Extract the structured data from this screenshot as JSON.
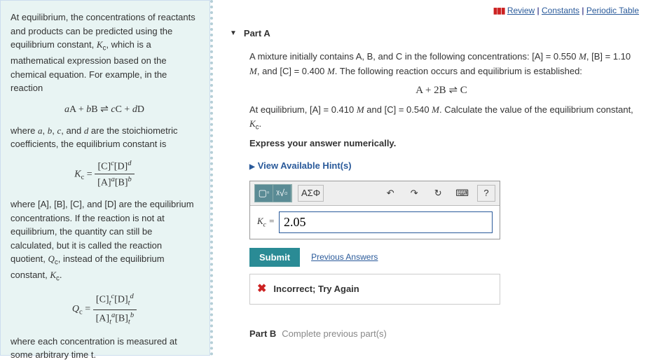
{
  "toplinks": {
    "review": "Review",
    "constants": "Constants",
    "periodic": "Periodic Table"
  },
  "left": {
    "intro": "At equilibrium, the concentrations of reactants and products can be predicted using the equilibrium constant, Kc, which is a mathematical expression based on the chemical equation. For example, in the reaction",
    "gen_eq": "aA + bB ⇌ cC + dD",
    "stoich": "where a, b, c, and d are the stoichiometric coefficients, the equilibrium constant is",
    "kc_label": "K",
    "kc_sub": "c",
    "kc_num": "[C]ᶜ[D]ᵈ",
    "kc_den": "[A]ᵃ[B]ᵇ",
    "where_eq": "where [A], [B], [C], and [D] are the equilibrium concentrations. If the reaction is not at equilibrium, the quantity can still be calculated, but it is called the reaction quotient, Qc, instead of the equilibrium constant, Kc.",
    "qc_label": "Q",
    "qc_sub": "c",
    "qc_num": "[C]ₜᶜ[D]ₜᵈ",
    "qc_den": "[A]ₜᵃ[B]ₜᵇ",
    "arb_time": "where each concentration is measured at some arbitrary time t."
  },
  "partA": {
    "label": "Part A",
    "q1a": "A mixture initially contains A, B, and C in the following concentrations: [A] = 0.550 ",
    "q1b": ", [B] = 1.10 ",
    "q1c": ", and [C] = 0.400 ",
    "q1d": ". The following reaction occurs and equilibrium is established:",
    "M": "M",
    "react_eq": "A + 2B ⇌ C",
    "q2a": "At equilibrium, [A] = 0.410 ",
    "q2b": " and [C] = 0.540 ",
    "q2c": ". Calculate the value of the equilibrium constant, ",
    "kc": "Kc",
    "express": "Express your answer numerically.",
    "hints": "View Available Hint(s)",
    "toolbar": {
      "frac": "√x",
      "greek": "ΑΣΦ",
      "undo": "↶",
      "redo": "↷",
      "reset": "↻",
      "keyboard": "⌨",
      "help": "?"
    },
    "kc_eq": "Kc =",
    "answer_value": "2.05",
    "submit": "Submit",
    "prev": "Previous Answers",
    "feedback": "Incorrect; Try Again"
  },
  "partB": {
    "label": "Part B",
    "note": "Complete previous part(s)"
  }
}
